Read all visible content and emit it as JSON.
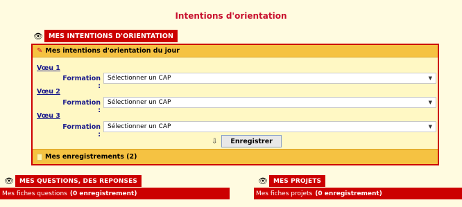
{
  "page_title": "Intentions d'orientation",
  "main_tab": {
    "label": "MES INTENTIONS D'ORIENTATION",
    "icon": "eye-icon"
  },
  "panel": {
    "header": "Mes intentions d'orientation du jour",
    "voeux": [
      {
        "title": "Vœu 1",
        "formation_label": "Formation :",
        "selected": "Sélectionner un CAP"
      },
      {
        "title": "Vœu 2",
        "formation_label": "Formation :",
        "selected": "Sélectionner un CAP"
      },
      {
        "title": "Vœu 3",
        "formation_label": "Formation :",
        "selected": "Sélectionner un CAP"
      }
    ],
    "save_label": "Enregistrer",
    "footer": "Mes enregistrements (2)"
  },
  "questions": {
    "tab_label": "MES QUESTIONS, DES REPONSES",
    "bar_text": "Mes fiches questions",
    "bar_count": "(0 enregistrement)"
  },
  "projets": {
    "tab_label": "MES PROJETS",
    "bar_text": "Mes fiches projets",
    "bar_count": "(0 enregistrement)"
  },
  "colors": {
    "accent": "#cc0000",
    "panel_bg": "#fff8c4",
    "header_bg": "#f5c242",
    "link": "#1a1a8c"
  }
}
